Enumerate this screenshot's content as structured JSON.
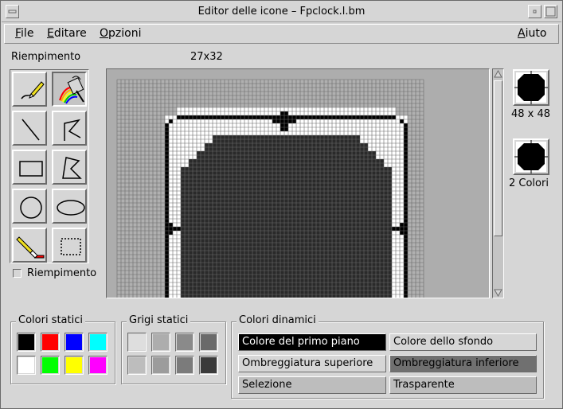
{
  "window": {
    "title": "Editor delle icone – Fpclock.l.bm"
  },
  "menu": {
    "file": {
      "mnemonic": "F",
      "rest": "ile"
    },
    "edit": {
      "mnemonic": "E",
      "rest": "ditare"
    },
    "options": {
      "mnemonic": "O",
      "rest": "pzioni"
    },
    "help": {
      "mnemonic": "A",
      "rest": "iuto"
    }
  },
  "tool_mode_label": "Riempimento",
  "canvas_size": "27x32",
  "tools": [
    {
      "name": "pencil-tool",
      "icon": "pencil-icon"
    },
    {
      "name": "fill-tool",
      "icon": "paint-bucket-icon",
      "selected": true
    },
    {
      "name": "line-tool",
      "icon": "line-icon"
    },
    {
      "name": "polyline-tool",
      "icon": "polyline-icon"
    },
    {
      "name": "rectangle-tool",
      "icon": "rectangle-icon"
    },
    {
      "name": "polygon-tool",
      "icon": "polygon-icon"
    },
    {
      "name": "circle-tool",
      "icon": "circle-icon"
    },
    {
      "name": "ellipse-tool",
      "icon": "ellipse-icon"
    },
    {
      "name": "eraser-tool",
      "icon": "eraser-icon"
    },
    {
      "name": "select-tool",
      "icon": "selection-icon"
    }
  ],
  "fill_checkbox_label": "Riempimento",
  "fill_checkbox_checked": false,
  "previews": [
    {
      "label": "48 x 48",
      "selected": false
    },
    {
      "label": "2 Colori",
      "selected": false
    }
  ],
  "static_colors": {
    "title": "Colori statici",
    "swatches": [
      "#000000",
      "#ff0000",
      "#0000ff",
      "#00ffff",
      "#ffffff",
      "#00ff00",
      "#ffff00",
      "#ff00ff"
    ]
  },
  "static_greys": {
    "title": "Grigi statici",
    "swatches": [
      "#dedede",
      "#adadad",
      "#8a8a8a",
      "#6a6a6a",
      "#bdbdbd",
      "#9c9c9c",
      "#7b7b7b",
      "#3a3a3a"
    ]
  },
  "dynamic_colors": {
    "title": "Colori dinamici",
    "buttons": [
      {
        "label": "Colore del primo piano",
        "bg": "#000000",
        "fg": "#ffffff"
      },
      {
        "label": "Colore dello sfondo",
        "bg": "#d6d6d6",
        "fg": "#000000"
      },
      {
        "label": "Ombreggiatura superiore",
        "bg": "#d6d6d6",
        "fg": "#000000"
      },
      {
        "label": "Ombreggiatura inferiore",
        "bg": "#707070",
        "fg": "#000000"
      },
      {
        "label": "Selezione",
        "bg": "#bdbdbd",
        "fg": "#000000"
      },
      {
        "label": "Trasparente",
        "bg": "#bdbdbd",
        "fg": "#000000"
      }
    ]
  },
  "colors": {
    "window_bg": "#d6d6d6",
    "canvas_bg": "#adadad",
    "pixel_on": "#000000",
    "pixel_off": "#ffffff",
    "grid": "#6a6a6a"
  }
}
